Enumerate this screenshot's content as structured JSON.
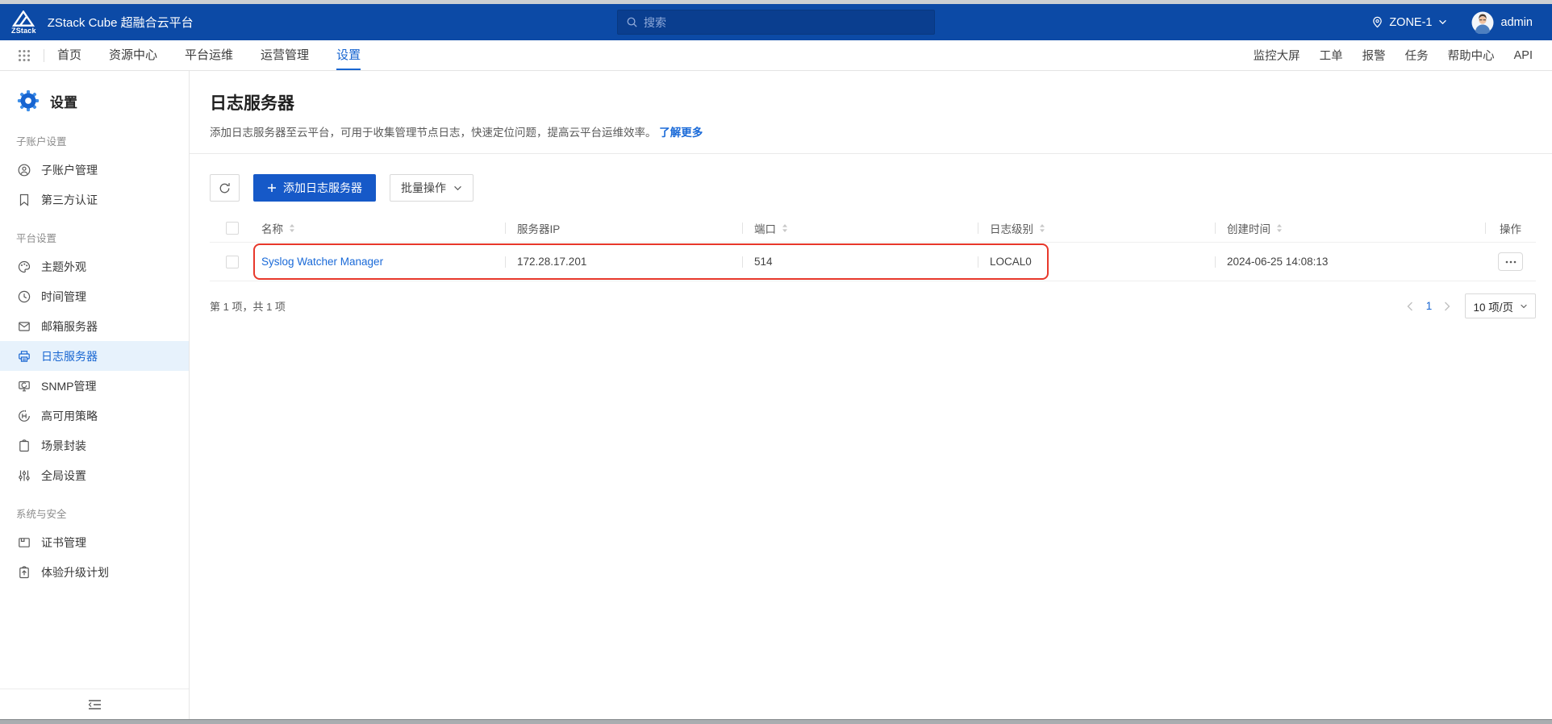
{
  "topbar": {
    "logo_text": "ZStack",
    "app_title": "ZStack Cube 超融合云平台",
    "search_placeholder": "搜索",
    "zone_label": "ZONE-1",
    "username": "admin",
    "icons": [
      "zstack-logo",
      "search-icon",
      "location-pin-icon",
      "chevron-down-icon",
      "avatar"
    ]
  },
  "navbar": {
    "apps_icon": "app-grid-icon",
    "tabs": [
      {
        "label": "首页"
      },
      {
        "label": "资源中心"
      },
      {
        "label": "平台运维"
      },
      {
        "label": "运营管理"
      },
      {
        "label": "设置",
        "active": true
      }
    ],
    "links": [
      "监控大屏",
      "工单",
      "报警",
      "任务",
      "帮助中心",
      "API"
    ]
  },
  "sidebar": {
    "title": "设置",
    "title_icon": "settings-gear-icon",
    "fold_icon": "menu-fold-icon",
    "sections": [
      {
        "label": "子账户设置",
        "items": [
          {
            "label": "子账户管理",
            "icon": "user-icon"
          },
          {
            "label": "第三方认证",
            "icon": "bookmark-icon"
          }
        ]
      },
      {
        "label": "平台设置",
        "items": [
          {
            "label": "主题外观",
            "icon": "palette-icon"
          },
          {
            "label": "时间管理",
            "icon": "clock-icon"
          },
          {
            "label": "邮箱服务器",
            "icon": "mail-icon"
          },
          {
            "label": "日志服务器",
            "icon": "log-server-icon",
            "active": true
          },
          {
            "label": "SNMP管理",
            "icon": "monitor-icon"
          },
          {
            "label": "高可用策略",
            "icon": "ha-circle-icon"
          },
          {
            "label": "场景封装",
            "icon": "clipboard-icon"
          },
          {
            "label": "全局设置",
            "icon": "sliders-icon"
          }
        ]
      },
      {
        "label": "系统与安全",
        "items": [
          {
            "label": "证书管理",
            "icon": "certificate-icon"
          },
          {
            "label": "体验升级计划",
            "icon": "upgrade-plan-icon"
          }
        ]
      }
    ]
  },
  "page": {
    "title": "日志服务器",
    "description": "添加日志服务器至云平台，可用于收集管理节点日志，快速定位问题，提高云平台运维效率。",
    "learn_more_label": "了解更多"
  },
  "toolbar": {
    "refresh_icon": "refresh-icon",
    "add_button_label": "添加日志服务器",
    "batch_button_label": "批量操作"
  },
  "table": {
    "columns": [
      "名称",
      "服务器IP",
      "端口",
      "日志级别",
      "创建时间",
      "操作"
    ],
    "sortable_columns": [
      "名称",
      "端口",
      "日志级别",
      "创建时间"
    ],
    "rows": [
      {
        "name": "Syslog Watcher Manager",
        "server_ip": "172.28.17.201",
        "port": "514",
        "log_level": "LOCAL0",
        "created_at": "2024-06-25 14:08:13"
      }
    ],
    "row_highlight": "red-annotation-box"
  },
  "pagination": {
    "summary": "第 1 项，共 1 项",
    "current_page": "1",
    "page_size": "10 项/页"
  },
  "colors": {
    "topbar_blue": "#0C4AA6",
    "search_bg": "#0A3E8F",
    "accent_blue": "#1765D1",
    "primary_button_blue": "#1659C8",
    "link_blue": "#1A6AD8",
    "active_item_bg": "#E7F2FC",
    "highlight_red": "#E8382B"
  }
}
